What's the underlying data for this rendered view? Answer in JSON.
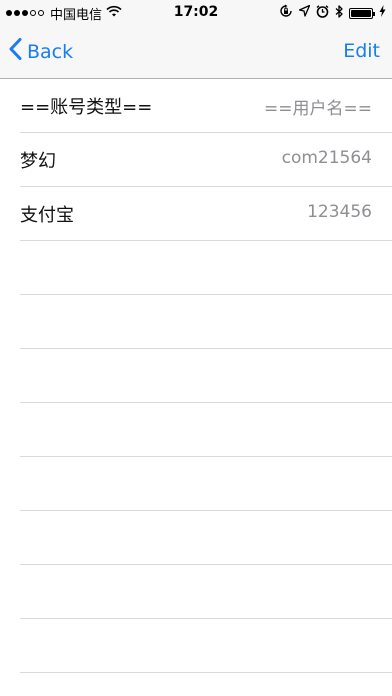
{
  "status_bar": {
    "carrier": "中国电信",
    "time": "17:02",
    "signal_dots": [
      "filled",
      "filled",
      "filled",
      "empty",
      "empty"
    ],
    "icons": [
      "wifi-icon",
      "orientation-lock-icon",
      "location-icon",
      "alarm-icon",
      "bluetooth-icon",
      "battery-icon",
      "charging-icon"
    ]
  },
  "nav": {
    "back_label": "Back",
    "edit_label": "Edit",
    "accent_color": "#1a7cf5"
  },
  "table": {
    "header": {
      "title": "==账号类型==",
      "detail": "==用户名=="
    },
    "rows": [
      {
        "title": "梦幻",
        "detail": "com21564"
      },
      {
        "title": "支付宝",
        "detail": "123456"
      }
    ]
  }
}
